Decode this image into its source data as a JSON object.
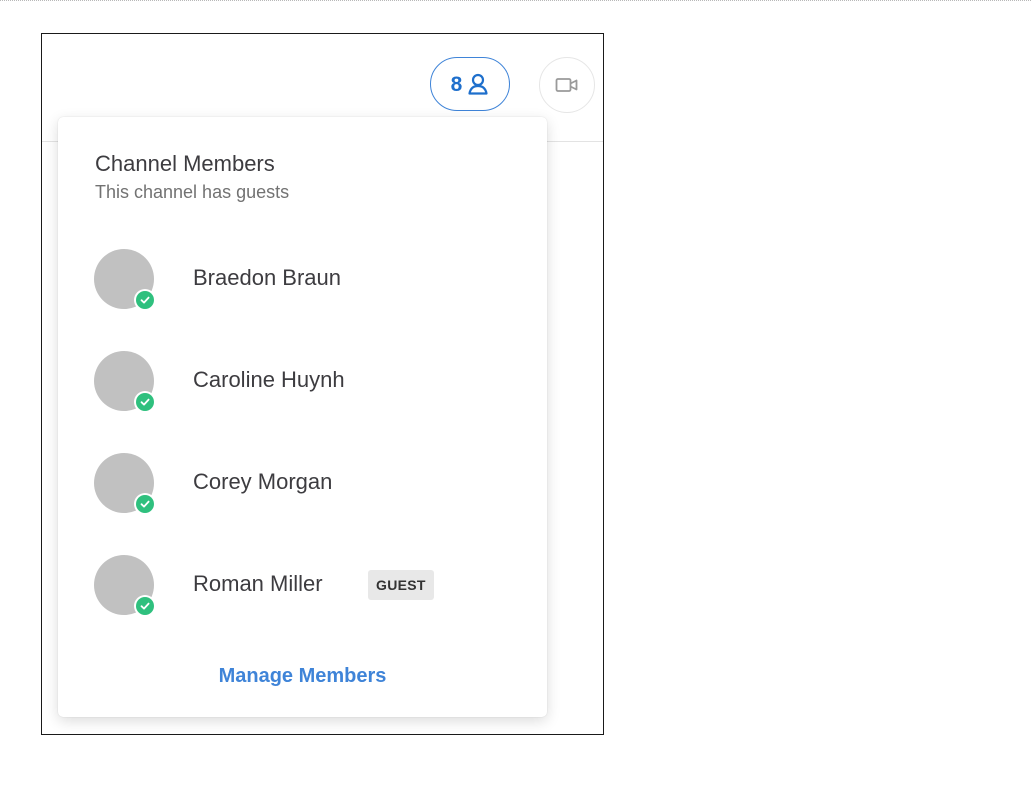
{
  "header": {
    "member_count": "8",
    "member_count_icon": "user-icon",
    "video_call_icon": "video-icon"
  },
  "popover": {
    "title": "Channel Members",
    "subtitle": "This channel has guests",
    "members": [
      {
        "name": "Braedon Braun",
        "status": "online",
        "badge": ""
      },
      {
        "name": "Caroline Huynh",
        "status": "online",
        "badge": ""
      },
      {
        "name": "Corey Morgan",
        "status": "online",
        "badge": ""
      },
      {
        "name": "Roman Miller",
        "status": "online",
        "badge": "GUEST"
      }
    ],
    "manage_label": "Manage Members"
  },
  "colors": {
    "accent": "#3f84d8",
    "status_online": "#2fc07e",
    "avatar_placeholder": "#c1c1c1"
  }
}
